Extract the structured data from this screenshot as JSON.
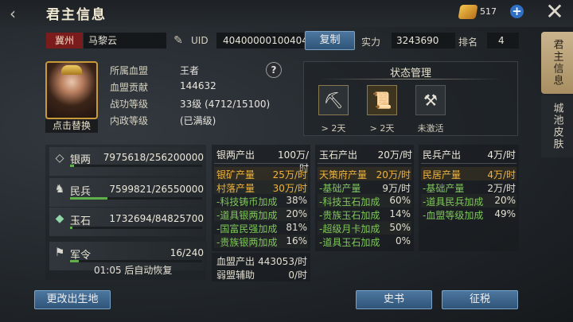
{
  "header": {
    "title": "君主信息",
    "gold_value": "517"
  },
  "side_tabs": [
    {
      "label": "君主信息"
    },
    {
      "label": "城池皮肤"
    }
  ],
  "profile": {
    "region": "冀州",
    "name": "马黎云",
    "uid_label": "UID",
    "uid": "40400000100404",
    "copy_label": "复制",
    "power_label": "实力",
    "power": "3243690",
    "rank_label": "排名",
    "rank": "4",
    "replace_label": "点击替换"
  },
  "info": [
    {
      "label": "所属血盟",
      "value": "王者"
    },
    {
      "label": "血盟贡献",
      "value": "144632"
    },
    {
      "label": "战功等级",
      "value": "33级 (4712/15100)"
    },
    {
      "label": "内政等级",
      "value": "(已满级)"
    }
  ],
  "status": {
    "title": "状态管理",
    "items": [
      {
        "label": "> 2天",
        "icon": "pickaxe-icon"
      },
      {
        "label": "> 2天",
        "icon": "scroll-icon"
      },
      {
        "label": "未激活",
        "icon": "anvil-icon"
      }
    ]
  },
  "resources": [
    {
      "name": "银两",
      "value": "7975618/256200000",
      "icon": "silver-icon",
      "fill": 0.031
    },
    {
      "name": "民兵",
      "value": "7599821/26550000",
      "icon": "soldier-icon",
      "fill": 0.286
    },
    {
      "name": "玉石",
      "value": "1732694/84825700",
      "icon": "jade-icon",
      "fill": 0.02
    },
    {
      "name": "军令",
      "value": "16/240",
      "icon": "token-icon",
      "fill": 0.067
    }
  ],
  "recover_text": "01:05 后自动恢复",
  "silver": {
    "head": "银两产出",
    "head_val": "100万/时",
    "rows": [
      {
        "label": "银矿产量",
        "value": "25万/时"
      },
      {
        "label": "村落产量",
        "value": "30万/时"
      },
      {
        "label": "-科技铸币加成",
        "value": "38%"
      },
      {
        "label": "-道具银两加成",
        "value": "20%"
      },
      {
        "label": "-国富民强加成",
        "value": "81%"
      },
      {
        "label": "-贵族银两加成",
        "value": "16%"
      }
    ]
  },
  "alliance": {
    "label": "血盟产出",
    "value": "443053/时",
    "sub_label": "弱盟辅助",
    "sub_value": "0/时"
  },
  "jade": {
    "head": "玉石产出",
    "head_val": "20万/时",
    "rows": [
      {
        "label": "天策府产量",
        "value": "20万/时"
      },
      {
        "label": "-基础产量",
        "value": "9万/时"
      },
      {
        "label": "-科技玉石加成",
        "value": "60%"
      },
      {
        "label": "-贵族玉石加成",
        "value": "14%"
      },
      {
        "label": "-超级月卡加成",
        "value": "50%"
      },
      {
        "label": "-道具玉石加成",
        "value": "0%"
      }
    ]
  },
  "militia": {
    "head": "民兵产出",
    "head_val": "4万/时",
    "rows": [
      {
        "label": "民居产量",
        "value": "4万/时"
      },
      {
        "label": "-基础产量",
        "value": "2万/时"
      },
      {
        "label": "-道具民兵加成",
        "value": "20%"
      },
      {
        "label": "-血盟等级加成",
        "value": "49%"
      }
    ]
  },
  "buttons": {
    "change_birthplace": "更改出生地",
    "history": "史书",
    "tax": "征税"
  }
}
